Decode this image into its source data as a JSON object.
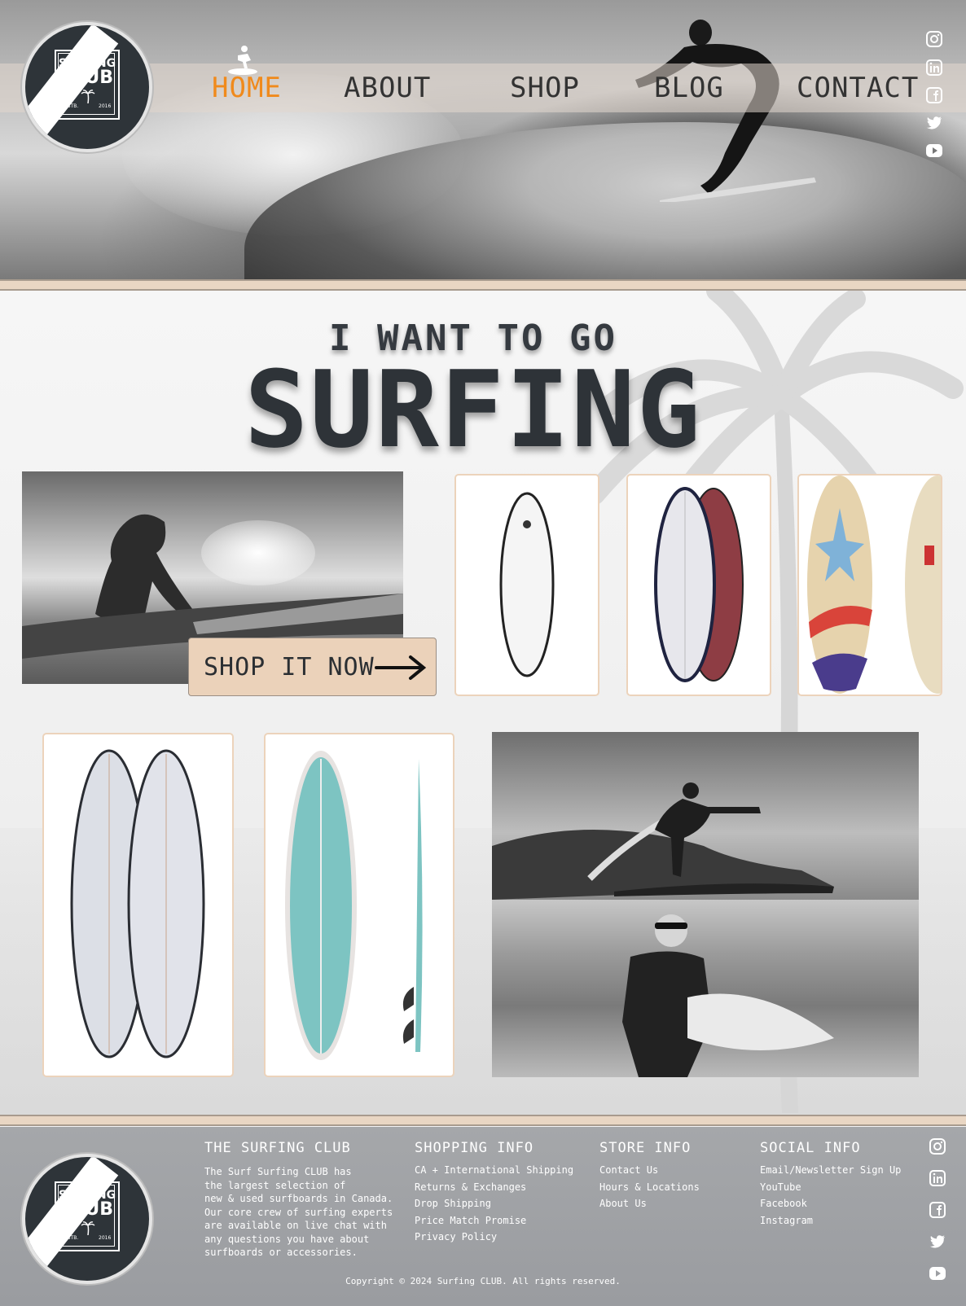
{
  "brand": {
    "line1": "SURFING",
    "line2": "CLUB",
    "estb": "ESTB.",
    "year": "2016"
  },
  "nav": {
    "home": "HOME",
    "about": "ABOUT",
    "shop": "SHOP",
    "blog": "BLOG",
    "contact": "CONTACT",
    "active": "HOME",
    "active_color": "#f08a1c"
  },
  "social_icons": [
    "instagram-icon",
    "linkedin-icon",
    "facebook-icon",
    "twitter-icon",
    "youtube-icon"
  ],
  "hero": {
    "tagline_small": "I WANT TO GO",
    "tagline_large": "SURFING"
  },
  "cta": {
    "label": "SHOP IT NOW"
  },
  "colors": {
    "accent_tan": "#ebd2ba",
    "dark_text": "#2e3338",
    "footer_bg": "#9d9fa3",
    "nav_active": "#f08a1c"
  },
  "footer": {
    "about": {
      "title": "THE SURFING CLUB",
      "lines": [
        "The Surf Surfing CLUB has",
        "the largest selection of",
        "new & used surfboards in Canada.",
        "Our core crew of surfing experts",
        "are available on live chat with",
        "any questions you have about",
        "surfboards or accessories."
      ]
    },
    "shopping": {
      "title": "SHOPPING INFO",
      "links": [
        "CA + International Shipping",
        "Returns & Exchanges",
        "Drop Shipping",
        "Price Match Promise",
        "Privacy Policy"
      ]
    },
    "store": {
      "title": "STORE INFO",
      "links": [
        "Contact Us",
        "Hours & Locations",
        "About Us"
      ]
    },
    "social": {
      "title": "SOCIAL INFO",
      "links": [
        "Email/Newsletter Sign Up",
        "YouTube",
        "Facebook",
        "Instagram"
      ]
    },
    "copyright": "Copyright © 2024 Surfing CLUB. All rights reserved."
  }
}
